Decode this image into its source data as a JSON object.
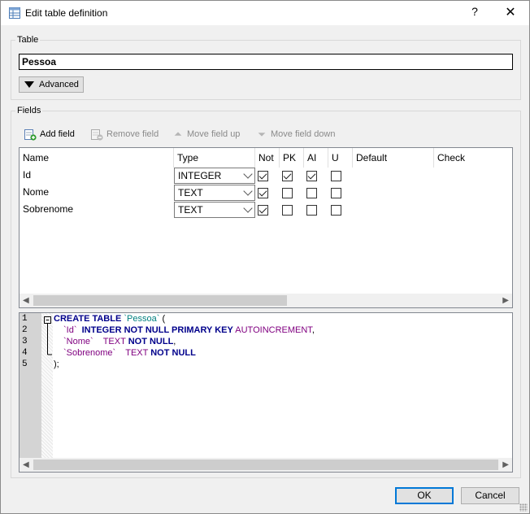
{
  "window": {
    "title": "Edit table definition",
    "help": "?",
    "close": "✕"
  },
  "table_group": {
    "label": "Table",
    "name_value": "Pessoa",
    "advanced_label": "Advanced"
  },
  "fields_group": {
    "label": "Fields",
    "toolbar": {
      "add": "Add field",
      "remove": "Remove field",
      "move_up": "Move field up",
      "move_down": "Move field down"
    },
    "columns": [
      "Name",
      "Type",
      "Not",
      "PK",
      "AI",
      "U",
      "Default",
      "Check"
    ],
    "rows": [
      {
        "name": "Id",
        "type": "INTEGER",
        "not": true,
        "pk": true,
        "ai": true,
        "u": false
      },
      {
        "name": "Nome",
        "type": "TEXT",
        "not": true,
        "pk": false,
        "ai": false,
        "u": false
      },
      {
        "name": "Sobrenome",
        "type": "TEXT",
        "not": true,
        "pk": false,
        "ai": false,
        "u": false
      }
    ]
  },
  "sql": {
    "line_numbers": [
      "1",
      "2",
      "3",
      "4",
      "5"
    ],
    "line1": {
      "kw": "CREATE TABLE",
      "ident": "`Pessoa`",
      "rest": " ("
    },
    "line2": {
      "ident": "`Id`",
      "kw": "INTEGER NOT NULL PRIMARY KEY",
      "str": "AUTOINCREMENT",
      "rest": ","
    },
    "line3": {
      "ident": "`Nome`",
      "str": "TEXT",
      "kw": "NOT NULL",
      "rest": ","
    },
    "line4": {
      "ident": "`Sobrenome`",
      "str": "TEXT",
      "kw": "NOT NULL"
    },
    "line5": ");"
  },
  "buttons": {
    "ok": "OK",
    "cancel": "Cancel"
  },
  "icons": [
    "table-icon",
    "add-field-icon",
    "remove-field-icon",
    "arrow-up-icon",
    "arrow-down-icon"
  ]
}
